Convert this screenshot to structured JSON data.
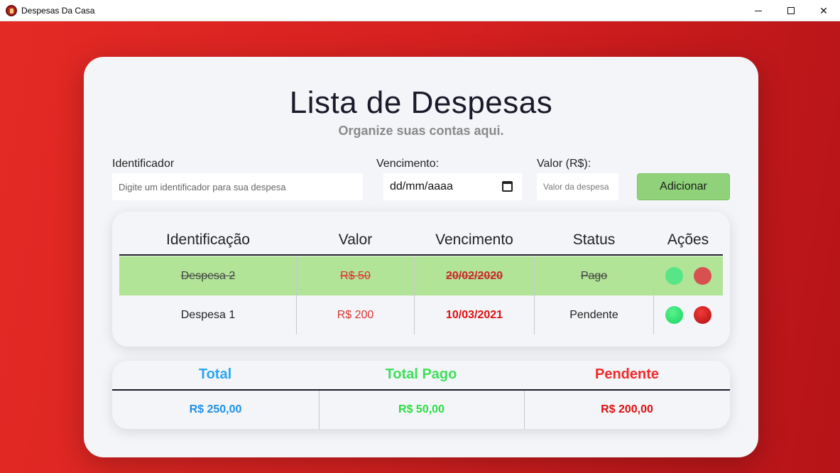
{
  "window": {
    "title": "Despesas Da Casa",
    "controls": {
      "minimize": "—",
      "maximize": "☐",
      "close": "✕"
    }
  },
  "header": {
    "title": "Lista de Despesas",
    "subtitle": "Organize suas contas aqui."
  },
  "form": {
    "identificador_label": "Identificador",
    "identificador_placeholder": "Digite um identificador para sua despesa",
    "vencimento_label": "Vencimento:",
    "vencimento_value": "dd/mm/aaaa",
    "valor_label": "Valor (R$):",
    "valor_placeholder": "Valor da despesa",
    "add_label": "Adicionar"
  },
  "table": {
    "headers": [
      "Identificação",
      "Valor",
      "Vencimento",
      "Status",
      "Ações"
    ],
    "rows": [
      {
        "id": "Despesa 2",
        "valor": "R$ 50",
        "vencimento": "20/02/2020",
        "status": "Pago",
        "paid": true
      },
      {
        "id": "Despesa 1",
        "valor": "R$ 200",
        "vencimento": "10/03/2021",
        "status": "Pendente",
        "paid": false
      }
    ]
  },
  "totals": {
    "total_label": "Total",
    "pago_label": "Total Pago",
    "pendente_label": "Pendente",
    "total_value": "R$ 250,00",
    "pago_value": "R$ 50,00",
    "pendente_value": "R$ 200,00"
  },
  "colors": {
    "background": "#d52020",
    "paid_row": "#b1e497",
    "add_button": "#8fd27a",
    "total": "#2aa7f0",
    "pago": "#3fe05a",
    "pendente": "#f02a2a"
  }
}
